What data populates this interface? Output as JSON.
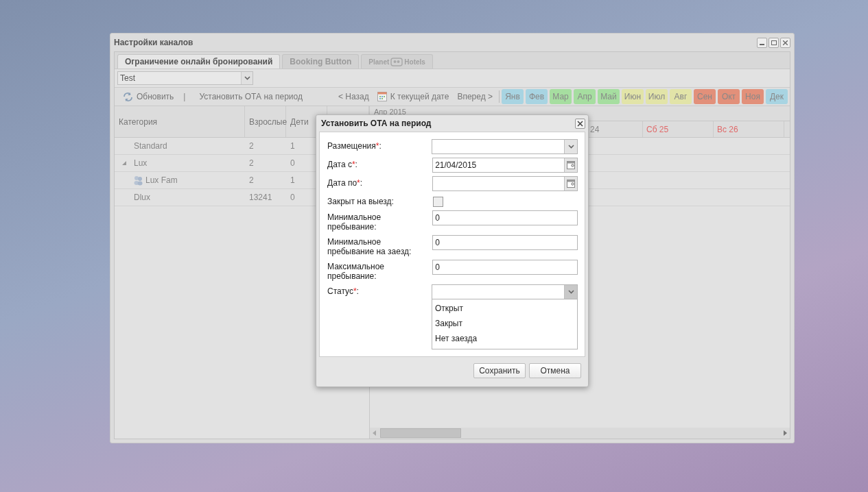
{
  "window": {
    "title": "Настройки каналов"
  },
  "tabs": [
    {
      "kind": "text",
      "label": "Ограничение онлайн бронирований",
      "selected": true
    },
    {
      "kind": "text",
      "label": "Booking Button",
      "selected": false
    },
    {
      "kind": "logo",
      "label_parts": [
        "Planet",
        "Hotels"
      ],
      "selected": false
    }
  ],
  "channel_select": {
    "value": "Test"
  },
  "toolbar": {
    "refresh": "Обновить",
    "separator": "|",
    "set_ota": "Установить ОТА на период",
    "back": "< Назад",
    "today": "К текущей дате",
    "forward": "Вперед >"
  },
  "months": [
    {
      "label": "Янв",
      "color": "#a8d4e2"
    },
    {
      "label": "Фев",
      "color": "#a8d4e2"
    },
    {
      "label": "Мар",
      "color": "#a6dea0"
    },
    {
      "label": "Апр",
      "color": "#a6dea0"
    },
    {
      "label": "Май",
      "color": "#a6dea0"
    },
    {
      "label": "Июн",
      "color": "#e2e4a8"
    },
    {
      "label": "Июл",
      "color": "#e2e4a8"
    },
    {
      "label": "Авг",
      "color": "#e2e4a8"
    },
    {
      "label": "Сен",
      "color": "#e2907a"
    },
    {
      "label": "Окт",
      "color": "#e2907a"
    },
    {
      "label": "Ноя",
      "color": "#e2907a"
    },
    {
      "label": "Дек",
      "color": "#a8d4e2"
    }
  ],
  "grid": {
    "columns": [
      "Категория",
      "Взрослые",
      "Дети"
    ],
    "rows": [
      {
        "name": "Standard",
        "adults": "2",
        "kids": "1"
      },
      {
        "name": "Lux",
        "adults": "2",
        "kids": "0",
        "expanded": true,
        "children": [
          {
            "name": "Lux Fam",
            "adults": "2",
            "kids": "1"
          }
        ]
      },
      {
        "name": "Dlux",
        "adults": "13241",
        "kids": "0"
      }
    ]
  },
  "calendar": {
    "month": "Апр 2015",
    "days": [
      {
        "label": "24",
        "weekend": false
      },
      {
        "label": "Сб 25",
        "weekend": true
      },
      {
        "label": "Вс 26",
        "weekend": true
      }
    ]
  },
  "dialog": {
    "title": "Установить ОТА на период",
    "fields": [
      {
        "kind": "combo",
        "label": "Размещения",
        "required_mark": "*",
        "label_suffix": ":"
      },
      {
        "kind": "date",
        "label": "Дата с",
        "required_mark": "*",
        "label_suffix": ":",
        "value": "21/04/2015"
      },
      {
        "kind": "date",
        "label": "Дата по",
        "required_mark": "*",
        "label_suffix": ":"
      },
      {
        "kind": "checkbox",
        "label": "Закрыт на выезд:",
        "checked": false
      },
      {
        "kind": "text",
        "label": "Минимальное пребывание:",
        "value": "0"
      },
      {
        "kind": "text",
        "label": "Минимальное пребывание на заезд:",
        "value": "0"
      },
      {
        "kind": "text",
        "label": "Максимальное пребывание:",
        "value": "0"
      },
      {
        "kind": "combo",
        "label": "Статус",
        "required_mark": "*",
        "label_suffix": ":",
        "expanded": true,
        "options": [
          {
            "label": "Открыт",
            "selected": false
          },
          {
            "label": "Закрыт",
            "selected": false
          },
          {
            "label": "Нет заезда",
            "selected": false
          }
        ]
      }
    ],
    "buttons": [
      "Сохранить",
      "Отмена"
    ]
  }
}
